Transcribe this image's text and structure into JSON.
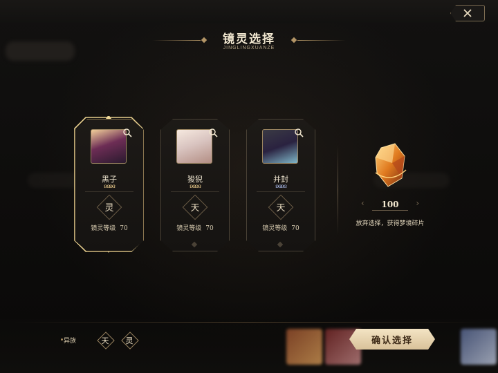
{
  "title": "镜灵选择",
  "subtitle": "JINGLINGXUANZE",
  "cards": [
    {
      "name": "黑子",
      "emblem": "灵",
      "level_label": "镜灵等级",
      "level": "70",
      "selected": true,
      "butterfly_color": "#e9c98a"
    },
    {
      "name": "狻猊",
      "emblem": "天",
      "level_label": "镜灵等级",
      "level": "70",
      "selected": false,
      "butterfly_color": "#e9c98a"
    },
    {
      "name": "并封",
      "emblem": "天",
      "level_label": "镜灵等级",
      "level": "70",
      "selected": false,
      "butterfly_color": "#a8b8e8"
    }
  ],
  "reward": {
    "count": "100",
    "text": "放弃选择，获得梦境碎片",
    "icon": "dream-fragment-crystal"
  },
  "filter": {
    "label": "异族",
    "options": [
      "天",
      "灵"
    ]
  },
  "confirm_label": "确认选择",
  "colors": {
    "accent_gold": "#e8d3a0",
    "frame": "#4a4236",
    "confirm_bg": "#ead7b0"
  }
}
